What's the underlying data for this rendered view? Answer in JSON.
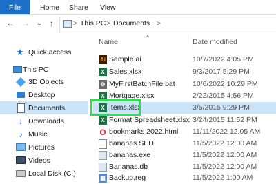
{
  "ribbon": {
    "tabs": [
      "File",
      "Home",
      "Share",
      "View"
    ]
  },
  "address": {
    "segments": [
      "This PC",
      "Documents"
    ],
    "separator": ">"
  },
  "columns": {
    "name": "Name",
    "date": "Date modified",
    "sort_indicator": "^"
  },
  "sidebar": {
    "items": [
      {
        "label": "Quick access",
        "icon": "star-icon"
      },
      {
        "label": "This PC",
        "icon": "computer-icon"
      },
      {
        "label": "3D Objects",
        "icon": "3d-objects-icon"
      },
      {
        "label": "Desktop",
        "icon": "desktop-icon"
      },
      {
        "label": "Documents",
        "icon": "documents-icon",
        "selected": true
      },
      {
        "label": "Downloads",
        "icon": "download-icon"
      },
      {
        "label": "Music",
        "icon": "music-icon"
      },
      {
        "label": "Pictures",
        "icon": "pictures-icon"
      },
      {
        "label": "Videos",
        "icon": "videos-icon"
      },
      {
        "label": "Local Disk (C:)",
        "icon": "disk-icon"
      }
    ]
  },
  "files": [
    {
      "name": "Sample.ai",
      "date": "10/7/2022 4:05 PM",
      "icon": "illustrator-icon",
      "color": "#3a1a00"
    },
    {
      "name": "Sales.xlsx",
      "date": "9/3/2017 5:29 PM",
      "icon": "excel-icon",
      "color": "#1d7044"
    },
    {
      "name": "MyFirstBatchFile.bat",
      "date": "10/6/2022 10:29 PM",
      "icon": "batch-icon",
      "color": "#6b6b6b"
    },
    {
      "name": "Mortgage.xlsx",
      "date": "2/22/2015 4:56 PM",
      "icon": "excel-icon",
      "color": "#1d7044"
    },
    {
      "name": "Items.xlsx",
      "date": "3/5/2015 9:29 PM",
      "icon": "excel-icon",
      "color": "#1d7044",
      "selected": true
    },
    {
      "name": "Format Spreadsheet.xlsx",
      "date": "3/24/2015 11:52 PM",
      "icon": "excel-icon",
      "color": "#1d7044"
    },
    {
      "name": "bookmarks 2022.html",
      "date": "11/11/2022 12:05 AM",
      "icon": "opera-icon",
      "color": "#e0242b"
    },
    {
      "name": "bananas.SED",
      "date": "11/5/2022 12:00 AM",
      "icon": "document-icon",
      "color": "#ffffff"
    },
    {
      "name": "bananas.exe",
      "date": "11/5/2022 12:00 AM",
      "icon": "exe-icon",
      "color": "#8aa0b8"
    },
    {
      "name": "Bananas.db",
      "date": "11/5/2022 12:00 AM",
      "icon": "database-icon",
      "color": "#8aa0b8"
    },
    {
      "name": "Backup.reg",
      "date": "11/5/2022 1:00 AM",
      "icon": "registry-icon",
      "color": "#5c88c4"
    }
  ]
}
